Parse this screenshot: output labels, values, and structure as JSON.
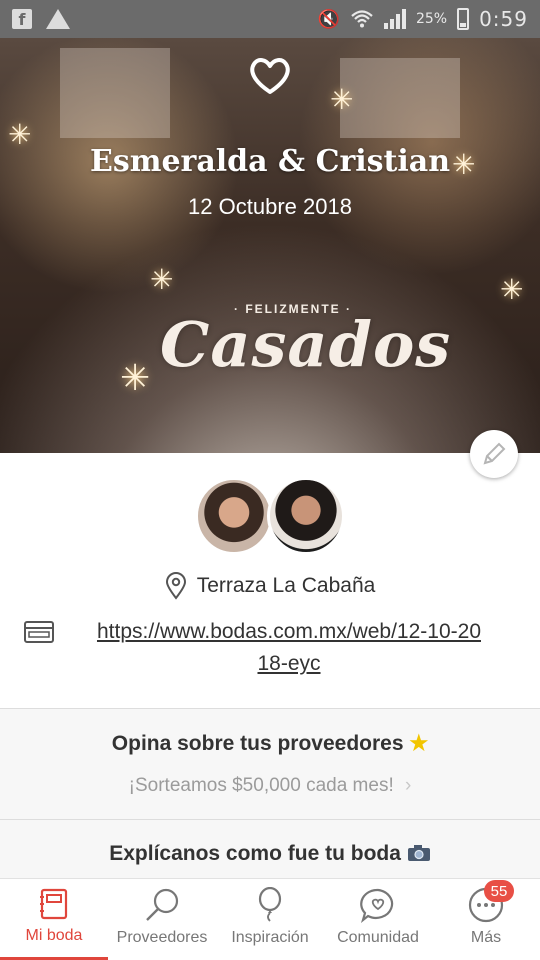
{
  "status_bar": {
    "battery": "25%",
    "time": "0:59",
    "icons": [
      "facebook-icon",
      "drive-icon",
      "mute-icon",
      "wifi-icon",
      "signal-icon",
      "battery-icon"
    ]
  },
  "hero": {
    "title": "Esmeralda & Cristian",
    "date": "12 Octubre 2018",
    "badge_small": "· FELIZMENTE ·",
    "badge_script": "Casados"
  },
  "couple": {
    "venue": "Terraza La Cabaña",
    "website_line1": "https://www.bodas.com.mx/web/12-10-20",
    "website_line2": "18-eyc"
  },
  "cards": [
    {
      "title": "Opina sobre tus proveedores",
      "title_icon": "star-icon",
      "subtitle": "¡Sorteamos $50,000 cada mes!"
    },
    {
      "title": "Explícanos como fue tu boda",
      "title_icon": "camera-icon"
    }
  ],
  "bottom_nav": {
    "items": [
      {
        "label": "Mi boda",
        "icon": "notebook-icon"
      },
      {
        "label": "Proveedores",
        "icon": "magnifier-icon"
      },
      {
        "label": "Inspiración",
        "icon": "balloon-icon"
      },
      {
        "label": "Comunidad",
        "icon": "chat-heart-icon"
      },
      {
        "label": "Más",
        "icon": "more-icon"
      }
    ],
    "badge": "55"
  },
  "colors": {
    "accent": "#e0463c",
    "badge": "#e84f45",
    "star": "#f2c500"
  }
}
